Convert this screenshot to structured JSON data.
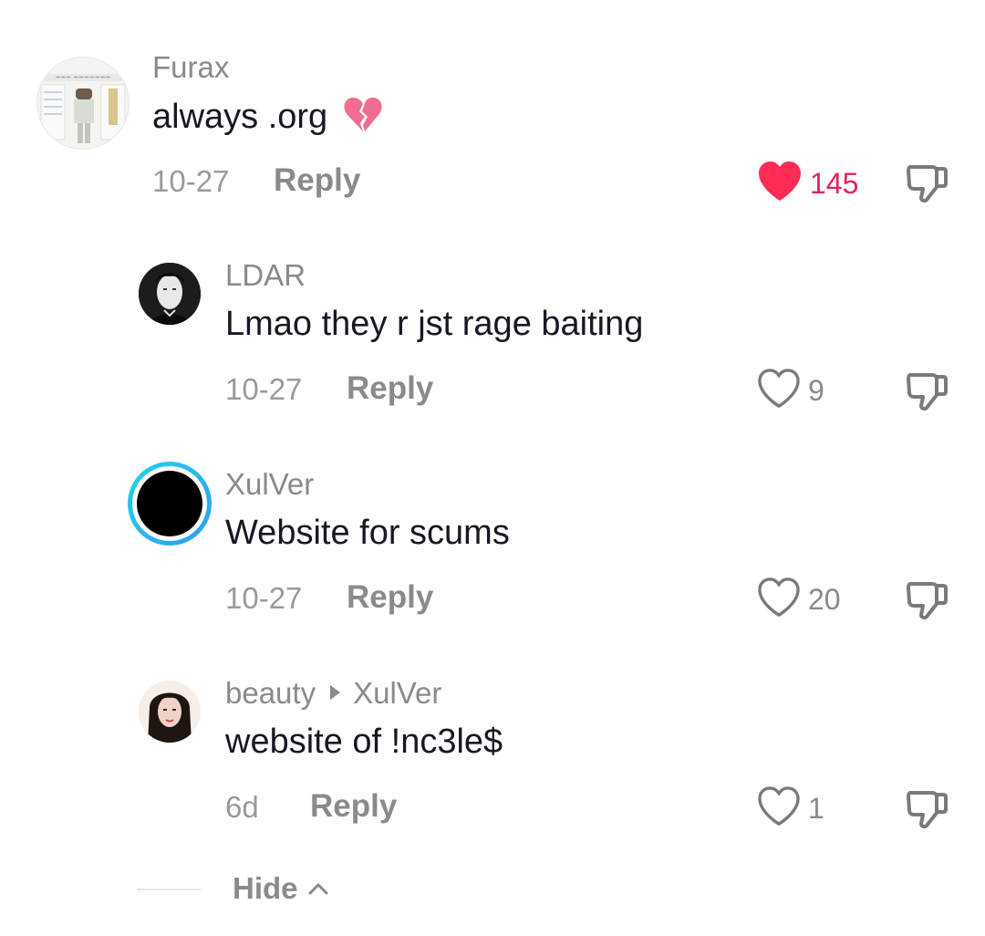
{
  "comments": [
    {
      "username": "Furax",
      "text": "always .org",
      "emoji": "💔",
      "date": "10-27",
      "reply_label": "Reply",
      "likes": "145",
      "liked": true
    },
    {
      "username": "LDAR",
      "text": "Lmao they r jst rage baiting",
      "date": "10-27",
      "reply_label": "Reply",
      "likes": "9",
      "liked": false
    },
    {
      "username": "XulVer",
      "text": "Website for scums",
      "date": "10-27",
      "reply_label": "Reply",
      "likes": "20",
      "liked": false
    },
    {
      "username": "beauty",
      "reply_to": "XulVer",
      "text": "website of !nc3le$",
      "date": "6d",
      "reply_label": "Reply",
      "likes": "1",
      "liked": false
    }
  ],
  "hide_label": "Hide",
  "colors": {
    "like_active": "#fe2c55",
    "story_ring_start": "#20d5ec",
    "story_ring_end": "#2f9bf0"
  }
}
